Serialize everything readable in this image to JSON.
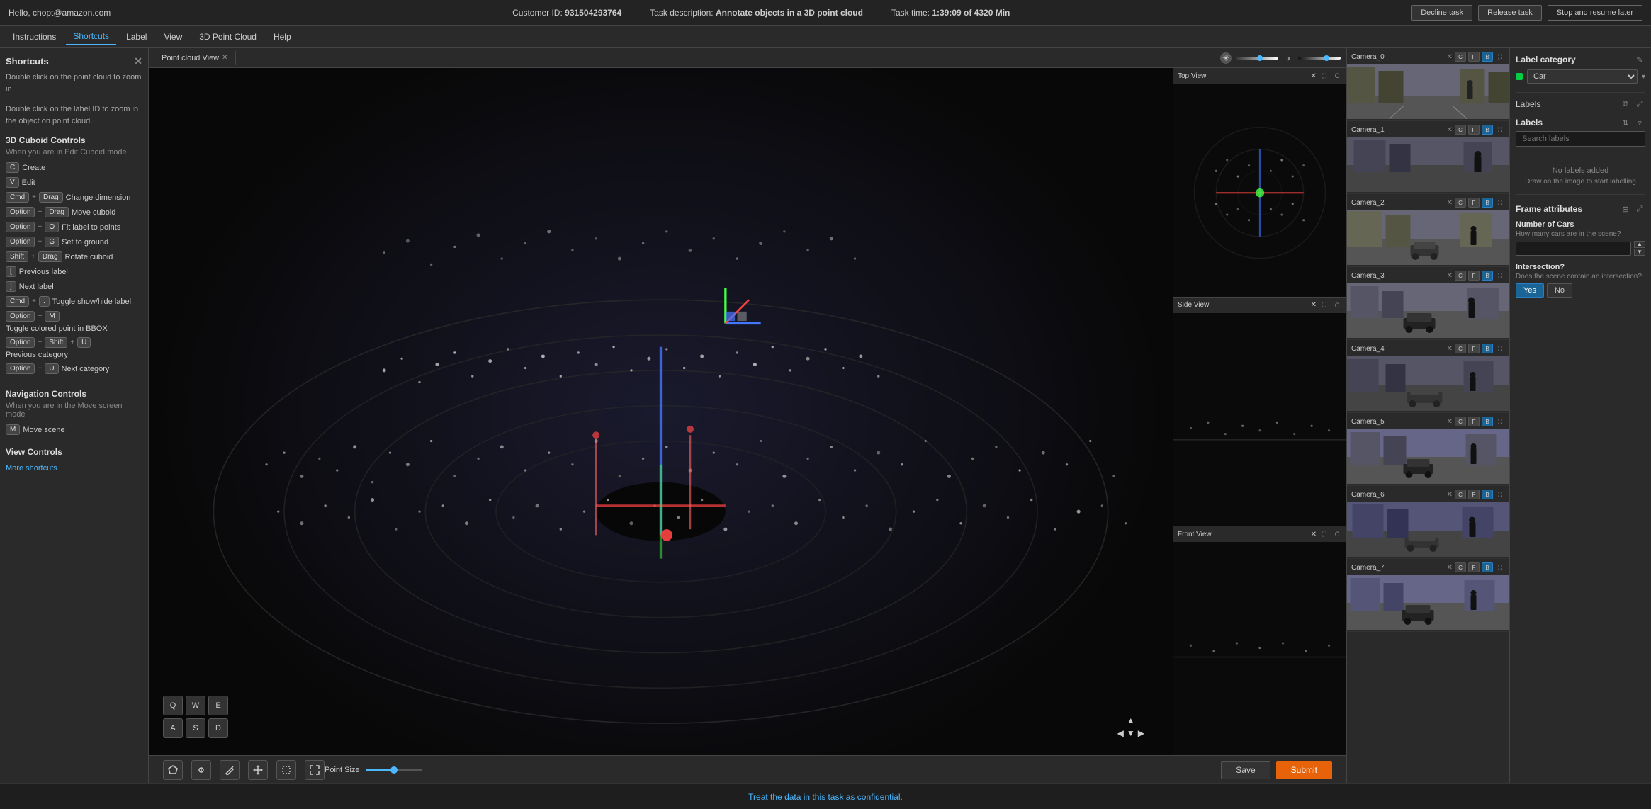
{
  "topbar": {
    "user": "Hello, chopt@amazon.com",
    "customer_id_label": "Customer ID:",
    "customer_id": "931504293764",
    "task_desc_label": "Task description:",
    "task_desc": "Annotate objects in a 3D point cloud",
    "task_time_label": "Task time:",
    "task_time": "1:39:09 of 4320 Min",
    "decline_task": "Decline task",
    "release_task": "Release task",
    "stop_resume": "Stop and resume later"
  },
  "menubar": {
    "items": [
      {
        "label": "Instructions",
        "active": false
      },
      {
        "label": "Shortcuts",
        "active": true
      },
      {
        "label": "Label",
        "active": false
      },
      {
        "label": "View",
        "active": false
      },
      {
        "label": "3D Point Cloud",
        "active": false
      },
      {
        "label": "Help",
        "active": false
      }
    ]
  },
  "left_panel": {
    "title": "Shortcuts",
    "desc1": "Double click on the point cloud to zoom in",
    "desc2": "Double click on the label ID to zoom in the object on point cloud.",
    "section_cuboid": "3D Cuboid Controls",
    "sub_cuboid": "When you are in Edit Cuboid mode",
    "shortcuts": [
      {
        "keys": [
          "C"
        ],
        "label": "Create"
      },
      {
        "keys": [
          "V"
        ],
        "label": "Edit"
      },
      {
        "keys": [
          "Cmd",
          "+",
          "Drag"
        ],
        "label": "Change dimension"
      },
      {
        "keys": [
          "Option",
          "+",
          "Drag"
        ],
        "label": "Move cuboid"
      },
      {
        "keys": [
          "Option",
          "+",
          "O"
        ],
        "label": "Fit label to points"
      },
      {
        "keys": [
          "Option",
          "+",
          "G"
        ],
        "label": "Set to ground"
      },
      {
        "keys": [
          "Shift",
          "+",
          "Drag"
        ],
        "label": "Rotate cuboid"
      },
      {
        "keys": [
          "["
        ],
        "label": "Previous label"
      },
      {
        "keys": [
          "]"
        ],
        "label": "Next label"
      },
      {
        "keys": [
          "Cmd",
          "+",
          "."
        ],
        "label": "Toggle show/hide label"
      },
      {
        "keys": [
          "Option",
          "+",
          "M"
        ],
        "label": "Toggle colored point in BBOX"
      },
      {
        "keys": [
          "Option",
          "+",
          "Shift",
          "+",
          "U"
        ],
        "label": "Previous category"
      },
      {
        "keys": [
          "Option",
          "+",
          "U"
        ],
        "label": "Next category"
      }
    ],
    "section_nav": "Navigation Controls",
    "sub_nav": "When you are in the Move screen mode",
    "nav_shortcuts": [
      {
        "keys": [
          "M"
        ],
        "label": "Move scene"
      }
    ],
    "section_view": "View Controls",
    "more_shortcuts": "More shortcuts"
  },
  "point_cloud_view": {
    "tab_label": "Point cloud View",
    "top_view_label": "Top View",
    "side_view_label": "Side View",
    "front_view_label": "Front View"
  },
  "bottom_toolbar": {
    "tools": [
      "draw-polygon",
      "draw-box",
      "pencil",
      "move",
      "select-region",
      "fullscreen"
    ],
    "point_size_label": "Point Size",
    "nav_keys": {
      "row1": [
        "Q",
        "W",
        "E"
      ],
      "row2": [
        "A",
        "S",
        "D"
      ]
    }
  },
  "cameras": [
    {
      "name": "Camera_0",
      "scene_class": "cam-scene-0"
    },
    {
      "name": "Camera_1",
      "scene_class": "cam-scene-1"
    },
    {
      "name": "Camera_2",
      "scene_class": "cam-scene-2"
    },
    {
      "name": "Camera_3",
      "scene_class": "cam-scene-3"
    },
    {
      "name": "Camera_4",
      "scene_class": "cam-scene-4"
    },
    {
      "name": "Camera_5",
      "scene_class": "cam-scene-5"
    },
    {
      "name": "Camera_6",
      "scene_class": "cam-scene-6"
    },
    {
      "name": "Camera_7",
      "scene_class": "cam-scene-7"
    }
  ],
  "right_panel": {
    "label_category_title": "Label category",
    "category_value": "Car",
    "labels_title": "Labels",
    "search_placeholder": "Search labels",
    "no_labels_msg": "No labels added",
    "draw_msg": "Draw on the image to start labelling",
    "frame_attrs_title": "Frame attributes",
    "num_cars_label": "Number of Cars",
    "num_cars_sub": "How many cars are in the scene?",
    "intersection_label": "Intersection?",
    "intersection_sub": "Does the scene contain an intersection?",
    "intersection_yes": "Yes",
    "intersection_no": "No"
  },
  "footer": {
    "message": "Treat the data in this task as confidential.",
    "save_label": "Save",
    "submit_label": "Submit"
  }
}
